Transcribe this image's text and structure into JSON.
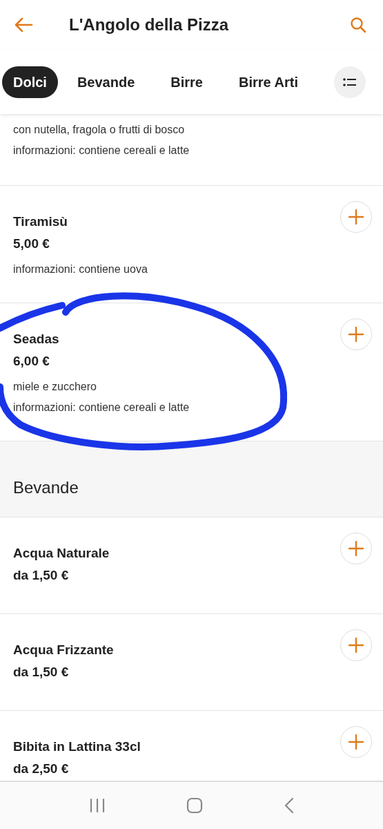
{
  "header": {
    "title": "L'Angolo della Pizza"
  },
  "tabs": [
    {
      "label": "Dolci",
      "selected": true
    },
    {
      "label": "Bevande",
      "selected": false
    },
    {
      "label": "Birre",
      "selected": false
    },
    {
      "label": "Birre Arti",
      "selected": false
    }
  ],
  "menu": [
    {
      "kind": "item",
      "lines": [
        "con nutella, fragola o frutti di bosco",
        "informazioni: contiene cereali e latte"
      ]
    },
    {
      "kind": "item",
      "name": "Tiramisù",
      "price": "5,00 €",
      "lines": [
        "informazioni: contiene uova"
      ]
    },
    {
      "kind": "item",
      "name": "Seadas",
      "price": "6,00 €",
      "lines": [
        "miele e zucchero",
        "informazioni: contiene cereali e latte"
      ]
    },
    {
      "kind": "section",
      "name": "Bevande"
    },
    {
      "kind": "item",
      "name": "Acqua Naturale",
      "price": "da 1,50 €"
    },
    {
      "kind": "item",
      "name": "Acqua Frizzante",
      "price": "da 1,50 €"
    },
    {
      "kind": "item",
      "name": "Bibita in Lattina 33cl",
      "price": "da 2,50 €"
    }
  ]
}
